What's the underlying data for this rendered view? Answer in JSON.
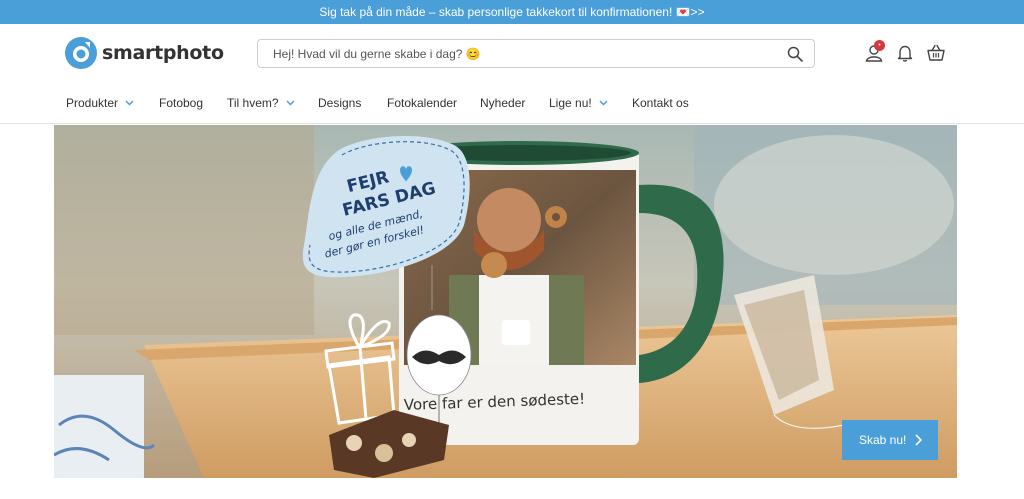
{
  "promo": {
    "text": "Sig tak på din måde – skab personlige takkekort til konfirmationen! 💌>>"
  },
  "header": {
    "logo_text": "smartphoto",
    "search_placeholder": "Hej! Hvad vil du gerne skabe i dag? 😊",
    "account_badge": "•",
    "icons": [
      "search-icon",
      "account-icon",
      "bell-icon",
      "basket-icon"
    ]
  },
  "nav": {
    "items": [
      {
        "label": "Produkter",
        "dropdown": true
      },
      {
        "label": "Fotobog",
        "dropdown": false
      },
      {
        "label": "Til hvem?",
        "dropdown": true
      },
      {
        "label": "Designs",
        "dropdown": false
      },
      {
        "label": "Fotokalender",
        "dropdown": false
      },
      {
        "label": "Nyheder",
        "dropdown": false
      },
      {
        "label": "Lige nu!",
        "dropdown": true
      },
      {
        "label": "Kontakt os",
        "dropdown": false
      }
    ]
  },
  "hero": {
    "bubble_line1": "FEJR",
    "bubble_line2": "FARS DAG",
    "bubble_line3": "og alle de mænd,",
    "bubble_line4": "der gør en forskel!",
    "mug_text": "Vore far er den sødeste!",
    "cta_label": "Skab nu!"
  },
  "colors": {
    "accent": "#4a9fd8",
    "mug_handle": "#2f6a4a",
    "tray": "#e2b583"
  }
}
